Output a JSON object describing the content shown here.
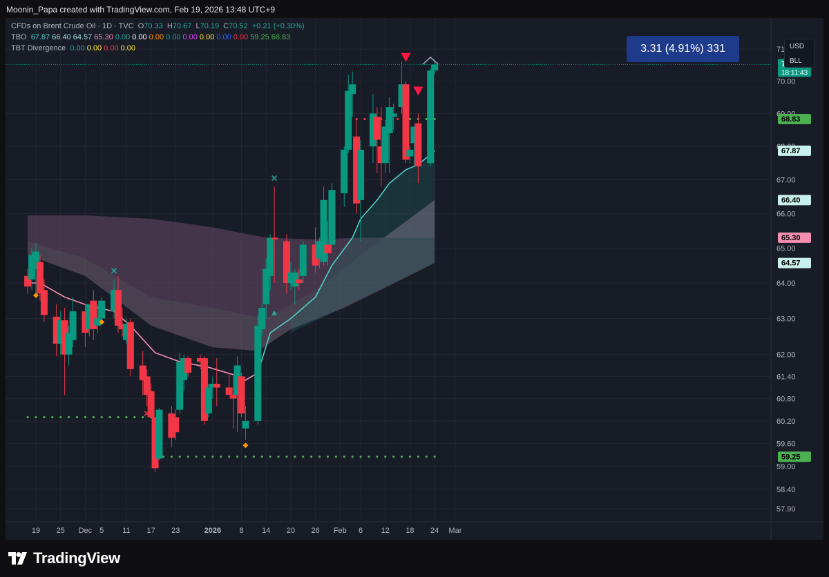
{
  "header": {
    "credit": "Moonin_Papa created with TradingView.com, Feb 19, 2026 13:48 UTC+9"
  },
  "legend": {
    "symbol": {
      "title": "CFDs on Brent Crude Oil · 1D · TVC",
      "o_label": "O",
      "o": "70.33",
      "h_label": "H",
      "h": "70.67",
      "l_label": "L",
      "l": "70.19",
      "c_label": "C",
      "c": "70.52",
      "change": "+0.21 (+0.30%)"
    },
    "tbo": {
      "name": "TBO",
      "values": [
        {
          "v": "67.87",
          "color": "#4dd0c8"
        },
        {
          "v": "66.40",
          "color": "#9fd9d4"
        },
        {
          "v": "64.57",
          "color": "#9fd9d4"
        },
        {
          "v": "65.30",
          "color": "#f48fb1"
        },
        {
          "v": "0.00",
          "color": "#26a69a"
        },
        {
          "v": "0.00",
          "color": "#ffffff"
        },
        {
          "v": "0.00",
          "color": "#ff9800"
        },
        {
          "v": "0.00",
          "color": "#26a69a"
        },
        {
          "v": "0.00",
          "color": "#e040fb"
        },
        {
          "v": "0.00",
          "color": "#ffeb3b"
        },
        {
          "v": "0.00",
          "color": "#2962ff"
        },
        {
          "v": "0.00",
          "color": "#f23645"
        },
        {
          "v": "59.25",
          "color": "#4caf50"
        },
        {
          "v": "68.83",
          "color": "#4caf50"
        }
      ]
    },
    "tbt": {
      "name": "TBT Divergence",
      "values": [
        {
          "v": "0.00",
          "color": "#26a69a"
        },
        {
          "v": "0.00",
          "color": "#ffeb3b"
        },
        {
          "v": "0.00",
          "color": "#f23645"
        },
        {
          "v": "0.00",
          "color": "#ffeb3b"
        }
      ]
    }
  },
  "currency": {
    "line1": "USD",
    "line2": "BLL"
  },
  "measure": {
    "text": "3.31 (4.91%) 331"
  },
  "footer": {
    "brand": "TradingView"
  },
  "colors": {
    "up": "#089981",
    "down": "#f23645",
    "bg": "#181c27",
    "grid": "#22262f",
    "fast": "#4dd0c8",
    "slow": "#f48fb1",
    "dots": "#4caf50"
  },
  "chart_data": {
    "type": "candlestick",
    "ylim": [
      57.6,
      71.55
    ],
    "y_scale": "log",
    "y_ticks": [
      "71.00",
      "70.00",
      "69.00",
      "68.00",
      "67.00",
      "66.00",
      "65.00",
      "64.00",
      "63.00",
      "62.00",
      "61.40",
      "60.80",
      "60.20",
      "59.60",
      "59.00",
      "58.40",
      "57.90"
    ],
    "x_ticks": [
      {
        "label": "19",
        "date": "2025-11-19"
      },
      {
        "label": "25",
        "date": "2025-11-25"
      },
      {
        "label": "Dec",
        "date": "2025-12-01"
      },
      {
        "label": "5",
        "date": "2025-12-05"
      },
      {
        "label": "11",
        "date": "2025-12-11"
      },
      {
        "label": "17",
        "date": "2025-12-17"
      },
      {
        "label": "23",
        "date": "2025-12-23"
      },
      {
        "label": "2026",
        "date": "2026-01-01"
      },
      {
        "label": "8",
        "date": "2026-01-08"
      },
      {
        "label": "14",
        "date": "2026-01-14"
      },
      {
        "label": "20",
        "date": "2026-01-20"
      },
      {
        "label": "26",
        "date": "2026-01-26"
      },
      {
        "label": "Feb",
        "date": "2026-02-01"
      },
      {
        "label": "6",
        "date": "2026-02-06"
      },
      {
        "label": "12",
        "date": "2026-02-12"
      },
      {
        "label": "18",
        "date": "2026-02-18"
      },
      {
        "label": "24",
        "date": "2026-02-24"
      },
      {
        "label": "Mar",
        "date": "2026-03-01"
      }
    ],
    "candles": [
      {
        "d": "2025-11-17",
        "o": 64.2,
        "h": 64.4,
        "l": 63.7,
        "c": 63.9
      },
      {
        "d": "2025-11-18",
        "o": 64.1,
        "h": 65.0,
        "l": 63.8,
        "c": 64.8
      },
      {
        "d": "2025-11-19",
        "o": 64.4,
        "h": 65.15,
        "l": 63.7,
        "c": 64.9
      },
      {
        "d": "2025-11-20",
        "o": 64.6,
        "h": 64.8,
        "l": 63.5,
        "c": 63.7
      },
      {
        "d": "2025-11-21",
        "o": 63.8,
        "h": 64.1,
        "l": 62.9,
        "c": 63.1
      },
      {
        "d": "2025-11-24",
        "o": 63.05,
        "h": 63.4,
        "l": 61.95,
        "c": 62.3
      },
      {
        "d": "2025-11-25",
        "o": 62.3,
        "h": 63.2,
        "l": 62.0,
        "c": 62.95
      },
      {
        "d": "2025-11-26",
        "o": 62.95,
        "h": 63.3,
        "l": 60.9,
        "c": 62.0
      },
      {
        "d": "2025-11-27",
        "o": 62.0,
        "h": 62.8,
        "l": 61.7,
        "c": 62.6
      },
      {
        "d": "2025-11-28",
        "o": 62.4,
        "h": 63.6,
        "l": 62.2,
        "c": 63.2
      },
      {
        "d": "2025-12-01",
        "o": 63.2,
        "h": 63.4,
        "l": 62.2,
        "c": 62.6
      },
      {
        "d": "2025-12-02",
        "o": 62.7,
        "h": 63.4,
        "l": 62.5,
        "c": 63.4
      },
      {
        "d": "2025-12-03",
        "o": 63.5,
        "h": 63.8,
        "l": 62.4,
        "c": 62.7
      },
      {
        "d": "2025-12-04",
        "o": 62.8,
        "h": 63.4,
        "l": 62.6,
        "c": 63.0
      },
      {
        "d": "2025-12-05",
        "o": 63.0,
        "h": 63.6,
        "l": 62.9,
        "c": 63.5
      },
      {
        "d": "2025-12-08",
        "o": 63.2,
        "h": 64.1,
        "l": 63.0,
        "c": 63.8
      },
      {
        "d": "2025-12-09",
        "o": 63.8,
        "h": 64.2,
        "l": 62.6,
        "c": 62.8
      },
      {
        "d": "2025-12-10",
        "o": 62.85,
        "h": 63.3,
        "l": 62.5,
        "c": 62.7
      },
      {
        "d": "2025-12-11",
        "o": 62.4,
        "h": 63.0,
        "l": 62.3,
        "c": 62.85
      },
      {
        "d": "2025-12-12",
        "o": 62.9,
        "h": 63.0,
        "l": 61.4,
        "c": 61.6
      },
      {
        "d": "2025-12-15",
        "o": 61.7,
        "h": 62.1,
        "l": 60.9,
        "c": 61.3
      },
      {
        "d": "2025-12-16",
        "o": 61.4,
        "h": 61.6,
        "l": 60.6,
        "c": 60.9
      },
      {
        "d": "2025-12-17",
        "o": 61.0,
        "h": 61.2,
        "l": 60.3,
        "c": 60.3
      },
      {
        "d": "2025-12-18",
        "o": 60.3,
        "h": 60.3,
        "l": 58.85,
        "c": 58.95
      },
      {
        "d": "2025-12-19",
        "o": 59.2,
        "h": 60.55,
        "l": 59.15,
        "c": 60.5
      },
      {
        "d": "2025-12-22",
        "o": 60.4,
        "h": 60.6,
        "l": 59.5,
        "c": 59.75
      },
      {
        "d": "2025-12-23",
        "o": 60.3,
        "h": 60.5,
        "l": 59.7,
        "c": 59.9
      },
      {
        "d": "2025-12-24",
        "o": 60.5,
        "h": 62.05,
        "l": 60.4,
        "c": 61.8
      },
      {
        "d": "2025-12-25",
        "o": 61.3,
        "h": 62.0,
        "l": 61.0,
        "c": 61.9
      },
      {
        "d": "2025-12-26",
        "o": 61.9,
        "h": 61.95,
        "l": 61.4,
        "c": 61.5
      },
      {
        "d": "2025-12-29",
        "o": 61.9,
        "h": 62.0,
        "l": 61.6,
        "c": 61.8
      },
      {
        "d": "2025-12-30",
        "o": 61.9,
        "h": 61.95,
        "l": 60.1,
        "c": 60.2
      },
      {
        "d": "2025-12-31",
        "o": 60.4,
        "h": 61.2,
        "l": 60.3,
        "c": 61.1
      },
      {
        "d": "2026-01-01",
        "o": 61.1,
        "h": 61.4,
        "l": 60.8,
        "c": 61.2
      },
      {
        "d": "2026-01-02",
        "o": 61.2,
        "h": 61.9,
        "l": 60.6,
        "c": 61.1
      },
      {
        "d": "2026-01-05",
        "o": 61.1,
        "h": 61.5,
        "l": 60.9,
        "c": 60.9
      },
      {
        "d": "2026-01-06",
        "o": 60.9,
        "h": 61.4,
        "l": 60.0,
        "c": 60.8
      },
      {
        "d": "2026-01-07",
        "o": 60.9,
        "h": 61.95,
        "l": 59.9,
        "c": 61.7
      },
      {
        "d": "2026-01-08",
        "o": 61.4,
        "h": 61.5,
        "l": 60.3,
        "c": 60.4
      },
      {
        "d": "2026-01-09",
        "o": 60.0,
        "h": 60.6,
        "l": 59.7,
        "c": 60.2
      },
      {
        "d": "2026-01-12",
        "o": 60.2,
        "h": 63.1,
        "l": 60.1,
        "c": 62.8
      },
      {
        "d": "2026-01-13",
        "o": 62.7,
        "h": 63.4,
        "l": 62.5,
        "c": 63.3
      },
      {
        "d": "2026-01-14",
        "o": 63.4,
        "h": 64.7,
        "l": 63.0,
        "c": 64.4
      },
      {
        "d": "2026-01-15",
        "o": 64.2,
        "h": 65.4,
        "l": 63.8,
        "c": 65.3
      },
      {
        "d": "2026-01-16",
        "o": 65.3,
        "h": 66.8,
        "l": 64.0,
        "c": 65.25
      },
      {
        "d": "2026-01-19",
        "o": 65.2,
        "h": 65.4,
        "l": 63.7,
        "c": 64.0
      },
      {
        "d": "2026-01-20",
        "o": 64.0,
        "h": 64.6,
        "l": 63.8,
        "c": 64.3
      },
      {
        "d": "2026-01-21",
        "o": 63.9,
        "h": 64.4,
        "l": 63.4,
        "c": 64.3
      },
      {
        "d": "2026-01-22",
        "o": 64.1,
        "h": 64.4,
        "l": 63.8,
        "c": 64.0
      },
      {
        "d": "2026-01-23",
        "o": 64.2,
        "h": 65.2,
        "l": 64.0,
        "c": 65.1
      },
      {
        "d": "2026-01-26",
        "o": 65.1,
        "h": 65.6,
        "l": 64.3,
        "c": 64.5
      },
      {
        "d": "2026-01-27",
        "o": 64.7,
        "h": 65.3,
        "l": 64.4,
        "c": 65.2
      },
      {
        "d": "2026-01-28",
        "o": 64.6,
        "h": 66.8,
        "l": 64.5,
        "c": 66.4
      },
      {
        "d": "2026-01-29",
        "o": 65.1,
        "h": 65.8,
        "l": 64.5,
        "c": 64.85
      },
      {
        "d": "2026-01-30",
        "o": 65.1,
        "h": 66.9,
        "l": 64.9,
        "c": 66.7
      },
      {
        "d": "2026-02-02",
        "o": 66.6,
        "h": 68.0,
        "l": 66.2,
        "c": 67.9
      },
      {
        "d": "2026-02-03",
        "o": 67.9,
        "h": 70.2,
        "l": 67.8,
        "c": 69.7
      },
      {
        "d": "2026-02-04",
        "o": 69.6,
        "h": 70.3,
        "l": 68.9,
        "c": 69.9
      },
      {
        "d": "2026-02-05",
        "o": 68.3,
        "h": 68.8,
        "l": 66.0,
        "c": 66.3
      },
      {
        "d": "2026-02-06",
        "o": 66.4,
        "h": 68.2,
        "l": 65.2,
        "c": 67.9
      },
      {
        "d": "2026-02-09",
        "o": 68.0,
        "h": 69.6,
        "l": 67.5,
        "c": 69.0
      },
      {
        "d": "2026-02-10",
        "o": 68.9,
        "h": 69.2,
        "l": 67.2,
        "c": 68.2
      },
      {
        "d": "2026-02-11",
        "o": 68.0,
        "h": 69.2,
        "l": 66.8,
        "c": 67.5
      },
      {
        "d": "2026-02-12",
        "o": 67.5,
        "h": 68.8,
        "l": 67.2,
        "c": 68.6
      },
      {
        "d": "2026-02-13",
        "o": 68.4,
        "h": 69.5,
        "l": 67.2,
        "c": 69.2
      },
      {
        "d": "2026-02-14",
        "o": 68.9,
        "h": 69.3,
        "l": 68.5,
        "c": 69.0
      },
      {
        "d": "2026-02-16",
        "o": 69.2,
        "h": 70.6,
        "l": 69.0,
        "c": 69.9
      },
      {
        "d": "2026-02-17",
        "o": 69.9,
        "h": 70.0,
        "l": 67.5,
        "c": 67.6
      },
      {
        "d": "2026-02-18",
        "o": 67.7,
        "h": 68.0,
        "l": 67.5,
        "c": 67.9
      },
      {
        "d": "2026-02-19",
        "o": 68.1,
        "h": 68.6,
        "l": 67.4,
        "c": 68.6
      },
      {
        "d": "2026-02-20",
        "o": 68.7,
        "h": 69.0,
        "l": 66.9,
        "c": 67.4
      },
      {
        "d": "2026-02-23",
        "o": 67.5,
        "h": 70.4,
        "l": 67.4,
        "c": 70.33
      },
      {
        "d": "2026-02-24",
        "o": 70.33,
        "h": 70.67,
        "l": 70.19,
        "c": 70.52
      }
    ],
    "ema_fast_points": [
      [
        "2025-11-17",
        64.0
      ],
      [
        "2025-11-20",
        64.0
      ],
      [
        "2025-11-26",
        63.6
      ],
      [
        "2025-12-02",
        63.35
      ],
      [
        "2025-12-08",
        63.2
      ],
      [
        "2025-12-12",
        62.8
      ],
      [
        "2025-12-18",
        62.05
      ],
      [
        "2025-12-24",
        61.8
      ],
      [
        "2025-12-31",
        61.65
      ],
      [
        "2026-01-06",
        61.45
      ],
      [
        "2026-01-09",
        61.3
      ],
      [
        "2026-01-12",
        61.5
      ],
      [
        "2026-01-15",
        62.6
      ],
      [
        "2026-01-20",
        63.0
      ],
      [
        "2026-01-26",
        63.6
      ],
      [
        "2026-01-30",
        64.5
      ],
      [
        "2026-02-04",
        65.3
      ],
      [
        "2026-02-06",
        65.85
      ],
      [
        "2026-02-10",
        66.4
      ],
      [
        "2026-02-13",
        66.9
      ],
      [
        "2026-02-17",
        67.3
      ],
      [
        "2026-02-20",
        67.45
      ],
      [
        "2026-02-24",
        67.87
      ]
    ],
    "band_upper_points": [
      [
        "2025-11-17",
        65.95
      ],
      [
        "2025-12-01",
        65.95
      ],
      [
        "2025-12-17",
        65.85
      ],
      [
        "2026-01-01",
        65.6
      ],
      [
        "2026-01-14",
        65.3
      ],
      [
        "2026-01-26",
        65.25
      ],
      [
        "2026-02-06",
        65.3
      ],
      [
        "2026-02-24",
        65.3
      ]
    ],
    "band_mid_points": [
      [
        "2025-11-17",
        65.2
      ],
      [
        "2025-12-01",
        64.7
      ],
      [
        "2025-12-17",
        63.6
      ],
      [
        "2026-01-01",
        63.3
      ],
      [
        "2026-01-14",
        63.0
      ],
      [
        "2026-01-26",
        63.8
      ],
      [
        "2026-02-06",
        64.8
      ],
      [
        "2026-02-24",
        66.4
      ]
    ],
    "band_lower_points": [
      [
        "2025-11-17",
        64.8
      ],
      [
        "2025-12-01",
        64.2
      ],
      [
        "2025-12-17",
        62.8
      ],
      [
        "2026-01-01",
        62.2
      ],
      [
        "2026-01-12",
        62.1
      ],
      [
        "2026-01-20",
        62.7
      ],
      [
        "2026-02-02",
        63.3
      ],
      [
        "2026-02-16",
        64.1
      ],
      [
        "2026-02-24",
        64.57
      ]
    ],
    "support_dots": [
      {
        "from": "2025-11-17",
        "to": "2025-12-17",
        "y": 60.3
      },
      {
        "from": "2025-12-18",
        "to": "2026-02-24",
        "y": 59.25
      }
    ],
    "resistance_dots": {
      "from": "2026-02-05",
      "to": "2026-02-24",
      "y": 68.83
    },
    "last_price_line": 70.52,
    "markers": [
      {
        "d": "2025-11-19",
        "type": "diamond",
        "color": "#ff9800",
        "y": 63.65
      },
      {
        "d": "2025-12-08",
        "type": "x",
        "color": "#26a69a",
        "y": 64.35
      },
      {
        "d": "2025-12-05",
        "type": "diamond",
        "color": "#ff9800",
        "y": 62.9
      },
      {
        "d": "2025-12-16",
        "type": "x",
        "color": "#f23645",
        "y": 60.4
      },
      {
        "d": "2026-01-09",
        "type": "diamond",
        "color": "#ff9800",
        "y": 59.55
      },
      {
        "d": "2026-01-16",
        "type": "x",
        "color": "#26a69a",
        "y": 67.05
      },
      {
        "d": "2026-01-16",
        "type": "tri-up",
        "color": "#26a69a",
        "y": 63.15
      },
      {
        "d": "2026-02-17",
        "type": "tri-down",
        "color": "#f23645",
        "y": 70.75
      },
      {
        "d": "2026-02-20",
        "type": "tri-down",
        "color": "#f23645",
        "y": 69.7
      }
    ],
    "price_labels": [
      {
        "value": "70.52",
        "y": 70.52,
        "bg": "#089981",
        "fg": "#ffffff",
        "sub": "18:11:43"
      },
      {
        "value": "68.83",
        "y": 68.83,
        "bg": "#4caf50",
        "fg": "#000000"
      },
      {
        "value": "67.87",
        "y": 67.87,
        "bg": "#c8f0ec",
        "fg": "#000000"
      },
      {
        "value": "66.40",
        "y": 66.4,
        "bg": "#c8f0ec",
        "fg": "#000000"
      },
      {
        "value": "65.30",
        "y": 65.3,
        "bg": "#f48fb1",
        "fg": "#000000"
      },
      {
        "value": "64.57",
        "y": 64.57,
        "bg": "#c8f0ec",
        "fg": "#000000"
      },
      {
        "value": "59.25",
        "y": 59.25,
        "bg": "#4caf50",
        "fg": "#000000"
      }
    ]
  }
}
